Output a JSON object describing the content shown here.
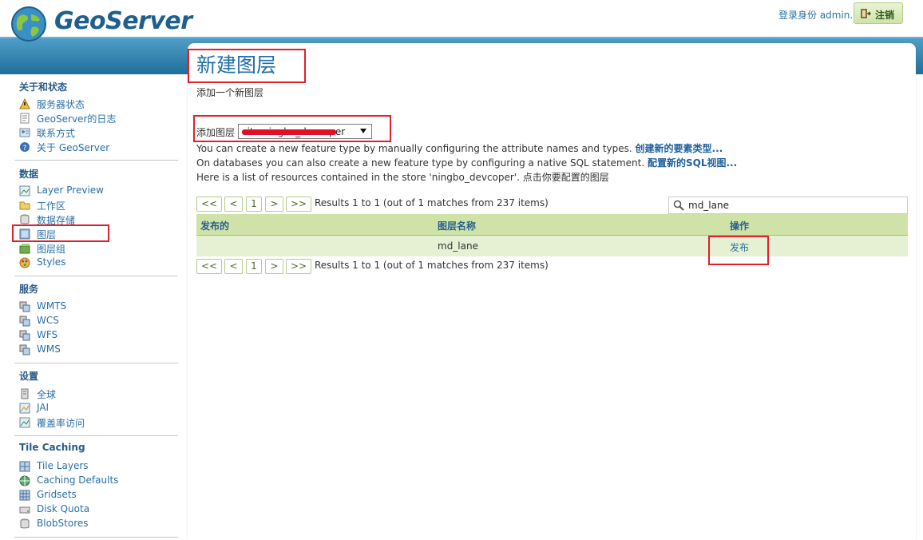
{
  "header": {
    "logo_text": "GeoServer",
    "login_text": "登录身份 admin.",
    "logout_label": "注销"
  },
  "sidebar": {
    "sections": [
      {
        "title": "关于和状态",
        "items": [
          {
            "label": "服务器状态",
            "icon": "server-status-icon"
          },
          {
            "label": "GeoServer的日志",
            "icon": "log-icon"
          },
          {
            "label": "联系方式",
            "icon": "contact-icon"
          },
          {
            "label": "关于 GeoServer",
            "icon": "about-icon"
          }
        ]
      },
      {
        "title": "数据",
        "items": [
          {
            "label": "Layer Preview",
            "icon": "layer-preview-icon"
          },
          {
            "label": "工作区",
            "icon": "workspace-icon"
          },
          {
            "label": "数据存储",
            "icon": "store-icon"
          },
          {
            "label": "图层",
            "icon": "layer-icon"
          },
          {
            "label": "图层组",
            "icon": "layergroup-icon"
          },
          {
            "label": "Styles",
            "icon": "styles-icon"
          }
        ]
      },
      {
        "title": "服务",
        "items": [
          {
            "label": "WMTS",
            "icon": "service-icon"
          },
          {
            "label": "WCS",
            "icon": "service-icon"
          },
          {
            "label": "WFS",
            "icon": "service-icon"
          },
          {
            "label": "WMS",
            "icon": "service-icon"
          }
        ]
      },
      {
        "title": "设置",
        "items": [
          {
            "label": "全球",
            "icon": "global-icon"
          },
          {
            "label": "JAI",
            "icon": "jai-icon"
          },
          {
            "label": "覆盖率访问",
            "icon": "coverage-icon"
          }
        ]
      },
      {
        "title": "Tile Caching",
        "items": [
          {
            "label": "Tile Layers",
            "icon": "tile-layers-icon"
          },
          {
            "label": "Caching Defaults",
            "icon": "caching-defaults-icon"
          },
          {
            "label": "Gridsets",
            "icon": "gridsets-icon"
          },
          {
            "label": "Disk Quota",
            "icon": "disk-quota-icon"
          },
          {
            "label": "BlobStores",
            "icon": "blobstores-icon"
          }
        ]
      }
    ]
  },
  "main": {
    "title": "新建图层",
    "subtitle": "添加一个新图层",
    "add_layer_label": "添加图层",
    "store_select_value": "cite:ningbo_devcoper",
    "line1_text": "You can create a new feature type by manually configuring the attribute names and types.",
    "line1_link": "创建新的要素类型...",
    "line2_text": "On databases you can also create a new feature type by configuring a native SQL statement.",
    "line2_link": "配置新的SQL视图...",
    "line3_text": "Here is a list of resources contained in the store 'ningbo_devcoper'. 点击你要配置的图层",
    "pager": {
      "first": "<<",
      "prev": "<",
      "page": "1",
      "next": ">",
      "last": ">>",
      "result_text": "Results 1 to 1 (out of 1 matches from 237 items)"
    },
    "search_value": "md_lane",
    "table": {
      "columns": [
        "发布的",
        "图层名称",
        "操作"
      ],
      "rows": [
        {
          "published": "",
          "name": "md_lane",
          "action": "发布"
        }
      ]
    }
  },
  "colors": {
    "accent": "#1e6ea8",
    "table_header": "#cfe3a8",
    "highlight_box": "#e0202a"
  }
}
